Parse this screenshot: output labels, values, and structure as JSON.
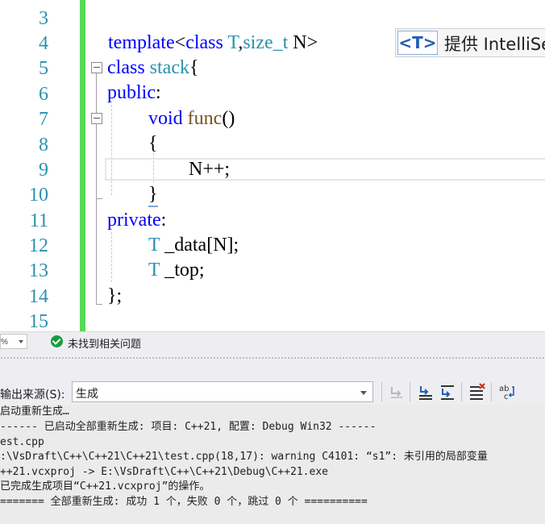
{
  "editor": {
    "line_numbers": [
      "3",
      "4",
      "5",
      "6",
      "7",
      "8",
      "9",
      "10",
      "11",
      "12",
      "13",
      "14",
      "15"
    ],
    "code": {
      "line4": {
        "kw1": "template",
        "punct1": "<",
        "kw2": "class",
        "sp": " ",
        "ty1": "T",
        "punct2": ",",
        "ty2": "size_t",
        "sp2": " ",
        "tx1": "N",
        "punct3": ">"
      },
      "line5": {
        "kw": "class",
        "sp": " ",
        "ty": "stack",
        "punct": "{"
      },
      "line6": {
        "kw": "public",
        "punct": ":"
      },
      "line7": {
        "kw": "void",
        "sp": " ",
        "fn": "func",
        "punct": "()"
      },
      "line8": {
        "punct": "{"
      },
      "line9": {
        "text": "N++;"
      },
      "line10": {
        "punct": "}"
      },
      "line11": {
        "kw": "private",
        "punct": ":"
      },
      "line12": {
        "ty": "T",
        "rest": " _data[N];"
      },
      "line13": {
        "ty": "T",
        "rest": " _top;"
      },
      "line14": {
        "punct": "};"
      }
    },
    "quick_info": {
      "icon_label": "<T>",
      "text": "提供 IntelliSense"
    }
  },
  "status_bar": {
    "issues_icon": "check-circle-icon",
    "issues_text": "未找到相关问题"
  },
  "output_panel": {
    "source_label": "输出来源(S):",
    "source_value": "生成",
    "lines": [
      "启动重新生成…",
      "------ 已启动全部重新生成: 项目: C++21, 配置: Debug Win32 ------",
      "est.cpp",
      ":\\VsDraft\\C++\\C++21\\C++21\\test.cpp(18,17): warning C4101: “s1”: 未引用的局部变量",
      "++21.vcxproj -> E:\\VsDraft\\C++\\C++21\\Debug\\C++21.exe",
      "已完成生成项目“C++21.vcxproj”的操作。",
      "======= 全部重新生成: 成功 1 个，失败 0 个，跳过 0 个 =========="
    ],
    "toolbar_icons": [
      "find-message-icon",
      "previous-message-icon",
      "next-message-icon",
      "clear-all-icon",
      "toggle-word-wrap-icon"
    ]
  },
  "colors": {
    "keyword": "#0000ff",
    "type": "#2b91af",
    "function": "#74531f",
    "change_bar": "#57d957"
  }
}
